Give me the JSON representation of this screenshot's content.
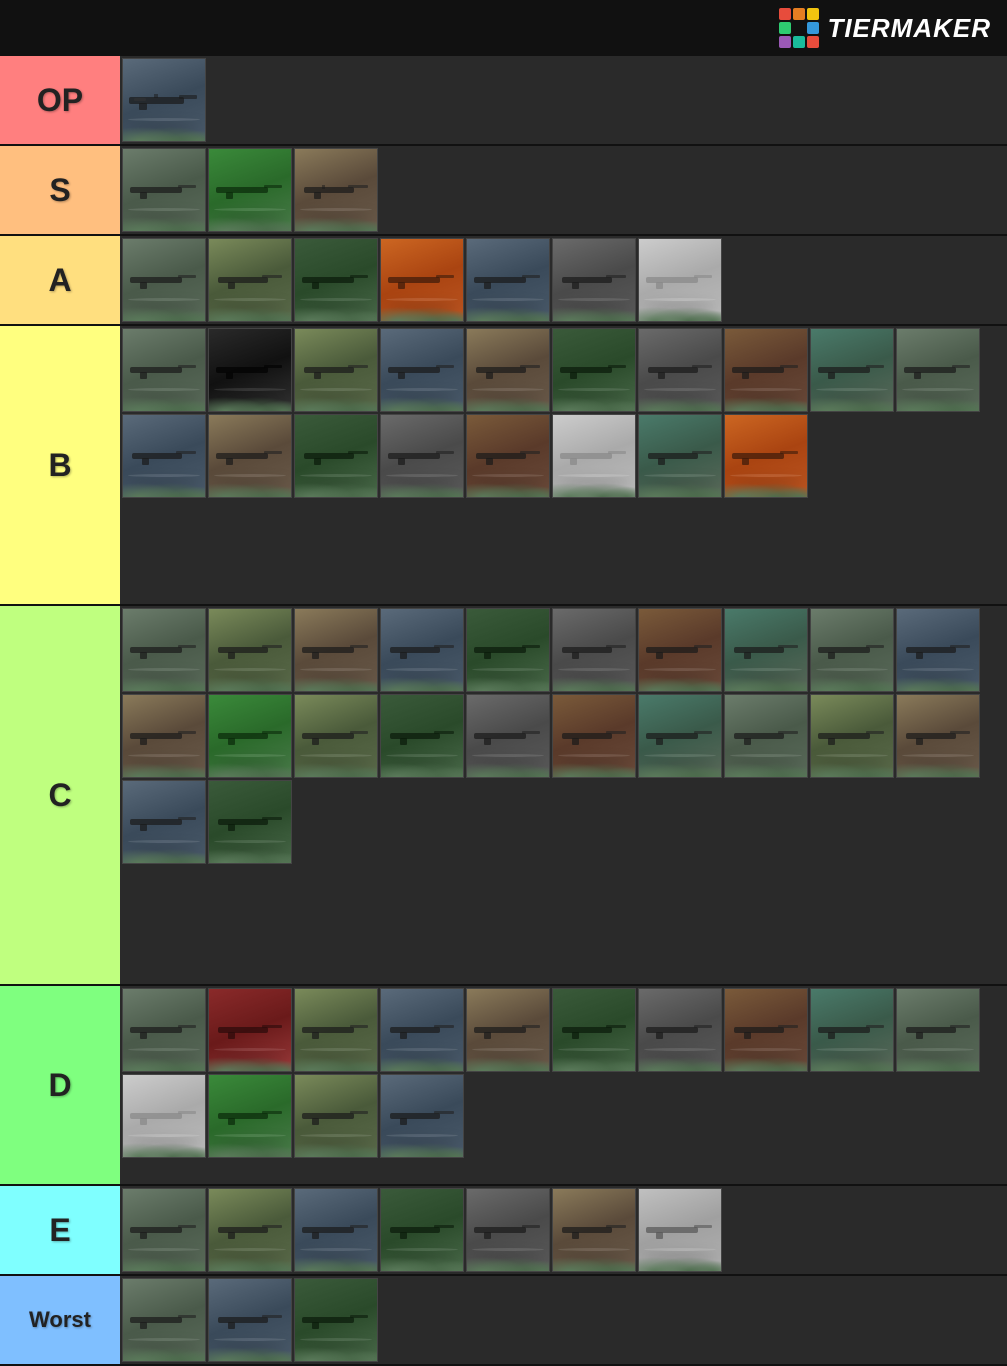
{
  "header": {
    "logo_text": "TiERMAKeR",
    "logo_colors": [
      "#e74c3c",
      "#e67e22",
      "#f1c40f",
      "#2ecc71",
      "#3498db",
      "#9b59b6",
      "#1abc9c",
      "#e74c3c",
      "#f39c12"
    ]
  },
  "tiers": [
    {
      "id": "op",
      "label": "OP",
      "color": "#ff7f7f",
      "item_count": 1,
      "items": [
        {
          "v": "v3"
        }
      ]
    },
    {
      "id": "s",
      "label": "S",
      "color": "#ffbf7f",
      "item_count": 3,
      "items": [
        {
          "v": "v1"
        },
        {
          "v": "green"
        },
        {
          "v": "v2"
        }
      ]
    },
    {
      "id": "a",
      "label": "A",
      "color": "#ffdf7f",
      "item_count": 7,
      "items": [
        {
          "v": "v1"
        },
        {
          "v": "v2"
        },
        {
          "v": "v4"
        },
        {
          "v": "orange"
        },
        {
          "v": "v3"
        },
        {
          "v": "v6"
        },
        {
          "v": "white"
        }
      ]
    },
    {
      "id": "b",
      "label": "B",
      "color": "#ffff7f",
      "item_count": 18,
      "items": [
        {
          "v": "v1"
        },
        {
          "v": "v5"
        },
        {
          "v": "dark"
        },
        {
          "v": "v2"
        },
        {
          "v": "v3"
        },
        {
          "v": "v4"
        },
        {
          "v": "v6"
        },
        {
          "v": "v7"
        },
        {
          "v": "v8"
        },
        {
          "v": "v1"
        },
        {
          "v": "v2"
        },
        {
          "v": "v3"
        },
        {
          "v": "v4"
        },
        {
          "v": "v5"
        },
        {
          "v": "v6"
        },
        {
          "v": "v7"
        },
        {
          "v": "white"
        },
        {
          "v": "v8"
        }
      ]
    },
    {
      "id": "c",
      "label": "C",
      "color": "#bfff7f",
      "item_count": 22,
      "items": [
        {
          "v": "v1"
        },
        {
          "v": "v2"
        },
        {
          "v": "v4"
        },
        {
          "v": "v3"
        },
        {
          "v": "v5"
        },
        {
          "v": "v6"
        },
        {
          "v": "v7"
        },
        {
          "v": "v8"
        },
        {
          "v": "v1"
        },
        {
          "v": "v2"
        },
        {
          "v": "v4"
        },
        {
          "v": "green"
        },
        {
          "v": "v3"
        },
        {
          "v": "v5"
        },
        {
          "v": "v6"
        },
        {
          "v": "v7"
        },
        {
          "v": "v8"
        },
        {
          "v": "v1"
        },
        {
          "v": "v2"
        },
        {
          "v": "v4"
        },
        {
          "v": "v3"
        },
        {
          "v": "v5"
        }
      ]
    },
    {
      "id": "d",
      "label": "D",
      "color": "#7fff7f",
      "item_count": 14,
      "items": [
        {
          "v": "v1"
        },
        {
          "v": "red"
        },
        {
          "v": "v2"
        },
        {
          "v": "v3"
        },
        {
          "v": "v4"
        },
        {
          "v": "v5"
        },
        {
          "v": "v6"
        },
        {
          "v": "v7"
        },
        {
          "v": "v8"
        },
        {
          "v": "v1"
        },
        {
          "v": "white"
        },
        {
          "v": "green"
        },
        {
          "v": "v2"
        },
        {
          "v": "v3"
        }
      ]
    },
    {
      "id": "e",
      "label": "E",
      "color": "#7fffff",
      "item_count": 7,
      "items": [
        {
          "v": "v1"
        },
        {
          "v": "v2"
        },
        {
          "v": "v3"
        },
        {
          "v": "v4"
        },
        {
          "v": "v5"
        },
        {
          "v": "v6"
        },
        {
          "v": "white"
        }
      ]
    },
    {
      "id": "worst",
      "label": "Worst",
      "color": "#7fbfff",
      "item_count": 3,
      "items": [
        {
          "v": "v1"
        },
        {
          "v": "v2"
        },
        {
          "v": "v3"
        }
      ]
    }
  ]
}
